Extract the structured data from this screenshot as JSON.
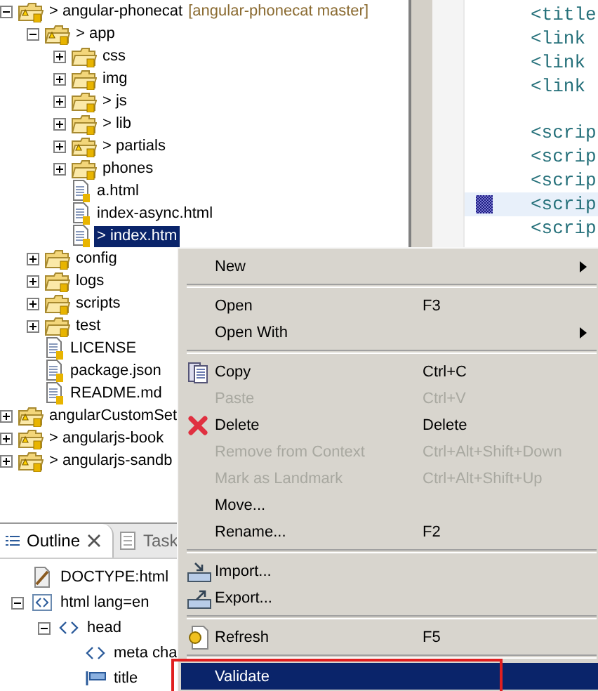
{
  "project_explorer": {
    "items": [
      {
        "label": "> angular-phonecat",
        "suffix": "[angular-phonecat master]",
        "kind": "project",
        "expanded": true,
        "selected": false,
        "children": [
          {
            "label": "> app",
            "kind": "project-folder",
            "expanded": true,
            "selected": false,
            "children": [
              {
                "label": "css",
                "kind": "folder",
                "expanded": false,
                "selected": false
              },
              {
                "label": "img",
                "kind": "folder",
                "expanded": false,
                "selected": false
              },
              {
                "label": "> js",
                "kind": "folder",
                "expanded": false,
                "selected": false
              },
              {
                "label": "> lib",
                "kind": "folder",
                "expanded": false,
                "selected": false
              },
              {
                "label": "> partials",
                "kind": "project-folder",
                "expanded": false,
                "selected": false
              },
              {
                "label": "phones",
                "kind": "folder",
                "expanded": false,
                "selected": false
              },
              {
                "label": "a.html",
                "kind": "file",
                "selected": false
              },
              {
                "label": "index-async.html",
                "kind": "file",
                "selected": false
              },
              {
                "label": "> index.htm",
                "kind": "file",
                "selected": true
              }
            ]
          },
          {
            "label": "config",
            "kind": "folder",
            "expanded": false,
            "selected": false
          },
          {
            "label": "logs",
            "kind": "folder",
            "expanded": false,
            "selected": false
          },
          {
            "label": "scripts",
            "kind": "folder",
            "expanded": false,
            "selected": false
          },
          {
            "label": "test",
            "kind": "folder",
            "expanded": false,
            "selected": false
          },
          {
            "label": "LICENSE",
            "kind": "file",
            "selected": false
          },
          {
            "label": "package.json",
            "kind": "file",
            "selected": false
          },
          {
            "label": "README.md",
            "kind": "file",
            "selected": false
          }
        ]
      },
      {
        "label": "angularCustomSet",
        "kind": "project",
        "expanded": false,
        "selected": false
      },
      {
        "label": "> angularjs-book",
        "kind": "project",
        "expanded": false,
        "selected": false
      },
      {
        "label": "> angularjs-sandb",
        "kind": "project",
        "expanded": false,
        "selected": false
      }
    ]
  },
  "outline": {
    "tabs": [
      {
        "label": "Outline",
        "selected": true
      },
      {
        "label": "Task",
        "selected": false
      }
    ],
    "items": [
      {
        "label": "DOCTYPE:html",
        "kind": "doctype",
        "selected": false
      },
      {
        "label": "html lang=en",
        "kind": "element",
        "expanded": true,
        "selected": false,
        "children": [
          {
            "label": "head",
            "kind": "tag",
            "expanded": true,
            "selected": false,
            "children": [
              {
                "label": "meta cha",
                "kind": "tag",
                "selected": false
              },
              {
                "label": "title",
                "kind": "text",
                "selected": false
              }
            ]
          }
        ]
      }
    ]
  },
  "editor": {
    "lines": [
      {
        "kind": "code",
        "text": "<title",
        "highlighted": false
      },
      {
        "kind": "code",
        "text": "<link",
        "highlighted": false
      },
      {
        "kind": "code",
        "text": "<link",
        "highlighted": false
      },
      {
        "kind": "code",
        "text": "<link",
        "highlighted": false
      },
      {
        "kind": "blank"
      },
      {
        "kind": "code",
        "text": "<scrip",
        "highlighted": false
      },
      {
        "kind": "code",
        "text": "<scrip",
        "highlighted": false
      },
      {
        "kind": "code",
        "text": "<scrip",
        "highlighted": false
      },
      {
        "kind": "code",
        "text": "<scrip",
        "highlighted": true
      },
      {
        "kind": "code",
        "text": "<scrip",
        "highlighted": false
      }
    ]
  },
  "context_menu": {
    "items": [
      {
        "kind": "item",
        "label": "New",
        "submenu": true,
        "disabled": false,
        "selected": false
      },
      {
        "kind": "separator"
      },
      {
        "kind": "item",
        "label": "Open",
        "shortcut": "F3",
        "disabled": false,
        "selected": false
      },
      {
        "kind": "item",
        "label": "Open With",
        "submenu": true,
        "disabled": false,
        "selected": false
      },
      {
        "kind": "separator"
      },
      {
        "kind": "item",
        "label": "Copy",
        "shortcut": "Ctrl+C",
        "disabled": false,
        "selected": false
      },
      {
        "kind": "item",
        "label": "Paste",
        "shortcut": "Ctrl+V",
        "disabled": true,
        "selected": false
      },
      {
        "kind": "item",
        "label": "Delete",
        "shortcut": "Delete",
        "disabled": false,
        "selected": false
      },
      {
        "kind": "item",
        "label": "Remove from Context",
        "shortcut": "Ctrl+Alt+Shift+Down",
        "disabled": true,
        "selected": false
      },
      {
        "kind": "item",
        "label": "Mark as Landmark",
        "shortcut": "Ctrl+Alt+Shift+Up",
        "disabled": true,
        "selected": false
      },
      {
        "kind": "item",
        "label": "Move...",
        "disabled": false,
        "selected": false
      },
      {
        "kind": "item",
        "label": "Rename...",
        "shortcut": "F2",
        "disabled": false,
        "selected": false
      },
      {
        "kind": "separator"
      },
      {
        "kind": "item",
        "label": "Import...",
        "disabled": false,
        "selected": false
      },
      {
        "kind": "item",
        "label": "Export...",
        "disabled": false,
        "selected": false
      },
      {
        "kind": "separator"
      },
      {
        "kind": "item",
        "label": "Refresh",
        "shortcut": "F5",
        "disabled": false,
        "selected": false
      },
      {
        "kind": "separator"
      },
      {
        "kind": "item",
        "label": "Validate",
        "disabled": false,
        "selected": true,
        "outlined": true
      }
    ]
  }
}
